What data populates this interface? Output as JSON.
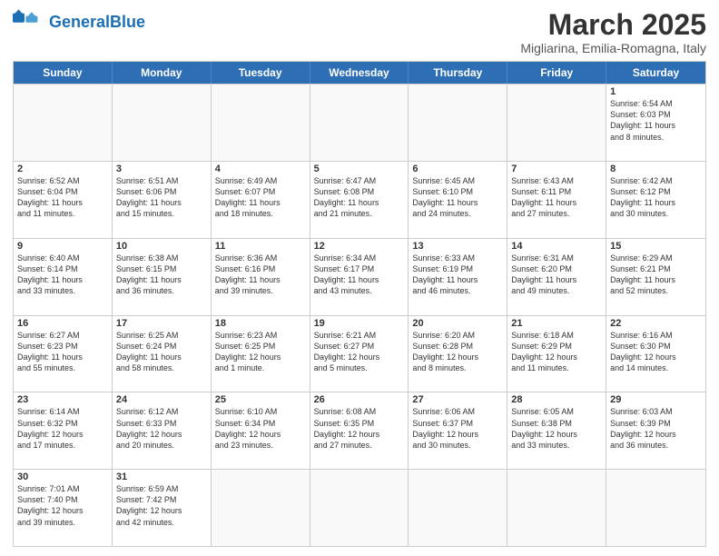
{
  "header": {
    "logo_general": "General",
    "logo_blue": "Blue",
    "month": "March 2025",
    "location": "Migliarina, Emilia-Romagna, Italy"
  },
  "weekdays": [
    "Sunday",
    "Monday",
    "Tuesday",
    "Wednesday",
    "Thursday",
    "Friday",
    "Saturday"
  ],
  "weeks": [
    [
      {
        "day": "",
        "info": ""
      },
      {
        "day": "",
        "info": ""
      },
      {
        "day": "",
        "info": ""
      },
      {
        "day": "",
        "info": ""
      },
      {
        "day": "",
        "info": ""
      },
      {
        "day": "",
        "info": ""
      },
      {
        "day": "1",
        "info": "Sunrise: 6:54 AM\nSunset: 6:03 PM\nDaylight: 11 hours\nand 8 minutes."
      }
    ],
    [
      {
        "day": "2",
        "info": "Sunrise: 6:52 AM\nSunset: 6:04 PM\nDaylight: 11 hours\nand 11 minutes."
      },
      {
        "day": "3",
        "info": "Sunrise: 6:51 AM\nSunset: 6:06 PM\nDaylight: 11 hours\nand 15 minutes."
      },
      {
        "day": "4",
        "info": "Sunrise: 6:49 AM\nSunset: 6:07 PM\nDaylight: 11 hours\nand 18 minutes."
      },
      {
        "day": "5",
        "info": "Sunrise: 6:47 AM\nSunset: 6:08 PM\nDaylight: 11 hours\nand 21 minutes."
      },
      {
        "day": "6",
        "info": "Sunrise: 6:45 AM\nSunset: 6:10 PM\nDaylight: 11 hours\nand 24 minutes."
      },
      {
        "day": "7",
        "info": "Sunrise: 6:43 AM\nSunset: 6:11 PM\nDaylight: 11 hours\nand 27 minutes."
      },
      {
        "day": "8",
        "info": "Sunrise: 6:42 AM\nSunset: 6:12 PM\nDaylight: 11 hours\nand 30 minutes."
      }
    ],
    [
      {
        "day": "9",
        "info": "Sunrise: 6:40 AM\nSunset: 6:14 PM\nDaylight: 11 hours\nand 33 minutes."
      },
      {
        "day": "10",
        "info": "Sunrise: 6:38 AM\nSunset: 6:15 PM\nDaylight: 11 hours\nand 36 minutes."
      },
      {
        "day": "11",
        "info": "Sunrise: 6:36 AM\nSunset: 6:16 PM\nDaylight: 11 hours\nand 39 minutes."
      },
      {
        "day": "12",
        "info": "Sunrise: 6:34 AM\nSunset: 6:17 PM\nDaylight: 11 hours\nand 43 minutes."
      },
      {
        "day": "13",
        "info": "Sunrise: 6:33 AM\nSunset: 6:19 PM\nDaylight: 11 hours\nand 46 minutes."
      },
      {
        "day": "14",
        "info": "Sunrise: 6:31 AM\nSunset: 6:20 PM\nDaylight: 11 hours\nand 49 minutes."
      },
      {
        "day": "15",
        "info": "Sunrise: 6:29 AM\nSunset: 6:21 PM\nDaylight: 11 hours\nand 52 minutes."
      }
    ],
    [
      {
        "day": "16",
        "info": "Sunrise: 6:27 AM\nSunset: 6:23 PM\nDaylight: 11 hours\nand 55 minutes."
      },
      {
        "day": "17",
        "info": "Sunrise: 6:25 AM\nSunset: 6:24 PM\nDaylight: 11 hours\nand 58 minutes."
      },
      {
        "day": "18",
        "info": "Sunrise: 6:23 AM\nSunset: 6:25 PM\nDaylight: 12 hours\nand 1 minute."
      },
      {
        "day": "19",
        "info": "Sunrise: 6:21 AM\nSunset: 6:27 PM\nDaylight: 12 hours\nand 5 minutes."
      },
      {
        "day": "20",
        "info": "Sunrise: 6:20 AM\nSunset: 6:28 PM\nDaylight: 12 hours\nand 8 minutes."
      },
      {
        "day": "21",
        "info": "Sunrise: 6:18 AM\nSunset: 6:29 PM\nDaylight: 12 hours\nand 11 minutes."
      },
      {
        "day": "22",
        "info": "Sunrise: 6:16 AM\nSunset: 6:30 PM\nDaylight: 12 hours\nand 14 minutes."
      }
    ],
    [
      {
        "day": "23",
        "info": "Sunrise: 6:14 AM\nSunset: 6:32 PM\nDaylight: 12 hours\nand 17 minutes."
      },
      {
        "day": "24",
        "info": "Sunrise: 6:12 AM\nSunset: 6:33 PM\nDaylight: 12 hours\nand 20 minutes."
      },
      {
        "day": "25",
        "info": "Sunrise: 6:10 AM\nSunset: 6:34 PM\nDaylight: 12 hours\nand 23 minutes."
      },
      {
        "day": "26",
        "info": "Sunrise: 6:08 AM\nSunset: 6:35 PM\nDaylight: 12 hours\nand 27 minutes."
      },
      {
        "day": "27",
        "info": "Sunrise: 6:06 AM\nSunset: 6:37 PM\nDaylight: 12 hours\nand 30 minutes."
      },
      {
        "day": "28",
        "info": "Sunrise: 6:05 AM\nSunset: 6:38 PM\nDaylight: 12 hours\nand 33 minutes."
      },
      {
        "day": "29",
        "info": "Sunrise: 6:03 AM\nSunset: 6:39 PM\nDaylight: 12 hours\nand 36 minutes."
      }
    ],
    [
      {
        "day": "30",
        "info": "Sunrise: 7:01 AM\nSunset: 7:40 PM\nDaylight: 12 hours\nand 39 minutes."
      },
      {
        "day": "31",
        "info": "Sunrise: 6:59 AM\nSunset: 7:42 PM\nDaylight: 12 hours\nand 42 minutes."
      },
      {
        "day": "",
        "info": ""
      },
      {
        "day": "",
        "info": ""
      },
      {
        "day": "",
        "info": ""
      },
      {
        "day": "",
        "info": ""
      },
      {
        "day": "",
        "info": ""
      }
    ]
  ]
}
